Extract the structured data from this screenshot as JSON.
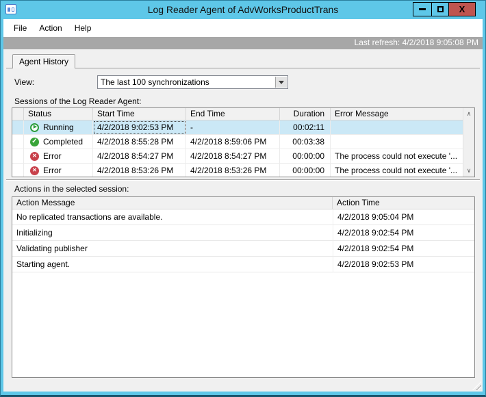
{
  "window": {
    "title": "Log Reader Agent of AdvWorksProductTrans",
    "close_label": "X"
  },
  "menu": {
    "items": [
      "File",
      "Action",
      "Help"
    ]
  },
  "status_strip": {
    "last_refresh": "Last refresh: 4/2/2018 9:05:08 PM"
  },
  "tab": {
    "label": "Agent History"
  },
  "view": {
    "label": "View:",
    "selected": "The last 100 synchronizations"
  },
  "sessions": {
    "label": "Sessions of the Log Reader Agent:",
    "columns": {
      "blank": "",
      "status": "Status",
      "start": "Start Time",
      "end": "End Time",
      "duration": "Duration",
      "error": "Error Message"
    },
    "rows": [
      {
        "icon": "running",
        "status": "Running",
        "start": "4/2/2018 9:02:53 PM",
        "end": "-",
        "duration": "00:02:11",
        "error": ""
      },
      {
        "icon": "completed",
        "status": "Completed",
        "start": "4/2/2018 8:55:28 PM",
        "end": "4/2/2018 8:59:06 PM",
        "duration": "00:03:38",
        "error": ""
      },
      {
        "icon": "error",
        "status": "Error",
        "start": "4/2/2018 8:54:27 PM",
        "end": "4/2/2018 8:54:27 PM",
        "duration": "00:00:00",
        "error": "The process could not execute '..."
      },
      {
        "icon": "error",
        "status": "Error",
        "start": "4/2/2018 8:53:26 PM",
        "end": "4/2/2018 8:53:26 PM",
        "duration": "00:00:00",
        "error": "The process could not execute '..."
      }
    ],
    "scrollbar": {
      "up": "∧",
      "down": "∨"
    }
  },
  "actions": {
    "label": "Actions in the selected session:",
    "columns": {
      "message": "Action Message",
      "time": "Action Time"
    },
    "rows": [
      {
        "message": "No replicated transactions are available.",
        "time": "4/2/2018 9:05:04 PM"
      },
      {
        "message": "Initializing",
        "time": "4/2/2018 9:02:54 PM"
      },
      {
        "message": "Validating publisher",
        "time": "4/2/2018 9:02:54 PM"
      },
      {
        "message": "Starting agent.",
        "time": "4/2/2018 9:02:53 PM"
      }
    ]
  },
  "colors": {
    "titlebar": "#5ec7e8",
    "close_button": "#bf554f",
    "refresh_strip": "#a7a7a7",
    "selected_row": "#cbe8f6",
    "running": "#2f9e3f",
    "completed": "#38a438",
    "error": "#c8414b"
  }
}
